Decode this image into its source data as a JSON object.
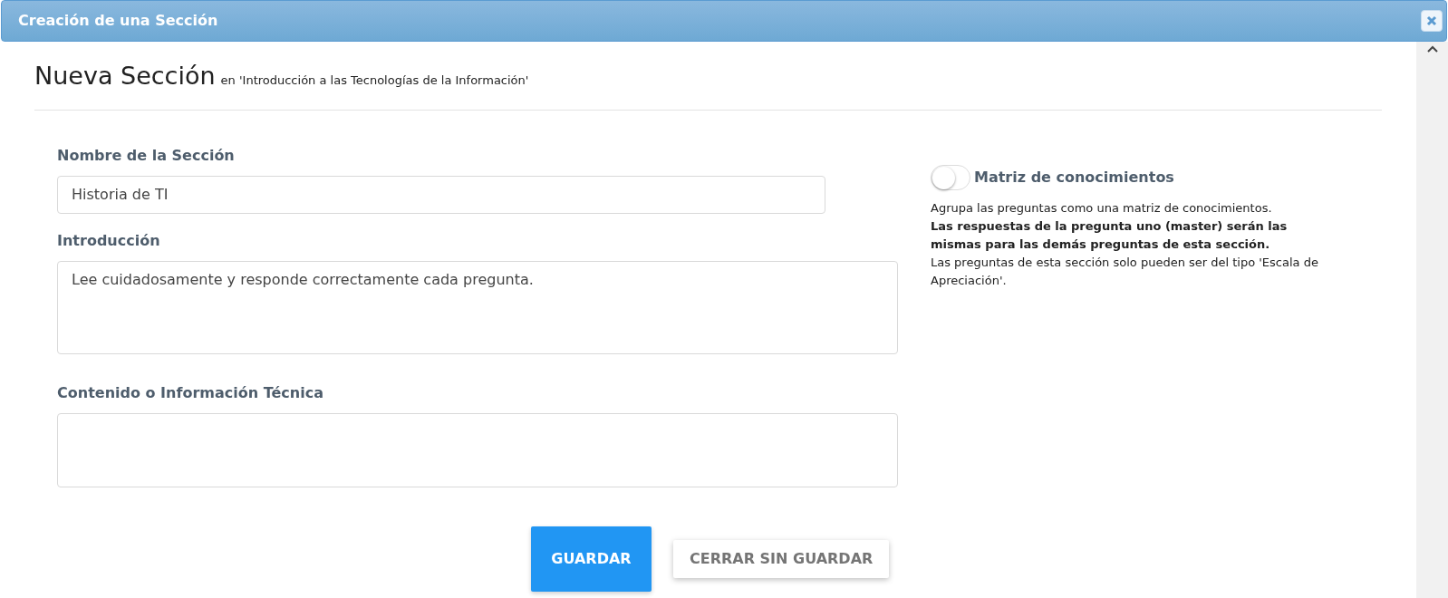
{
  "window": {
    "title": "Creación de una Sección"
  },
  "heading": {
    "title": "Nueva Sección",
    "subtitle": "en 'Introducción a las Tecnologías de la Información'"
  },
  "fields": [
    {
      "label": "Nombre de la Sección",
      "kind": "input",
      "value": "Historia de TI"
    },
    {
      "label": "Introducción",
      "kind": "textarea",
      "value": "Lee cuidadosamente y responde correctamente cada pregunta."
    },
    {
      "label": "Contenido o Información Técnica",
      "kind": "textarea-short"
    }
  ],
  "matrix": {
    "label": "Matriz de conocimientos",
    "on": false,
    "notes": [
      {
        "text": "Agrupa las preguntas como una matriz de conocimientos.",
        "bold": false
      },
      {
        "text": "Las respuestas de la pregunta uno (master) serán las mismas para las demás preguntas de esta sección.",
        "bold": true
      },
      {
        "text": "Las preguntas de esta sección solo pueden ser del tipo 'Escala de Apreciación'.",
        "bold": false
      }
    ]
  },
  "buttons": [
    {
      "label": "GUARDAR",
      "kind": "primary"
    },
    {
      "label": "CERRAR SIN GUARDAR",
      "kind": "secondary"
    }
  ]
}
